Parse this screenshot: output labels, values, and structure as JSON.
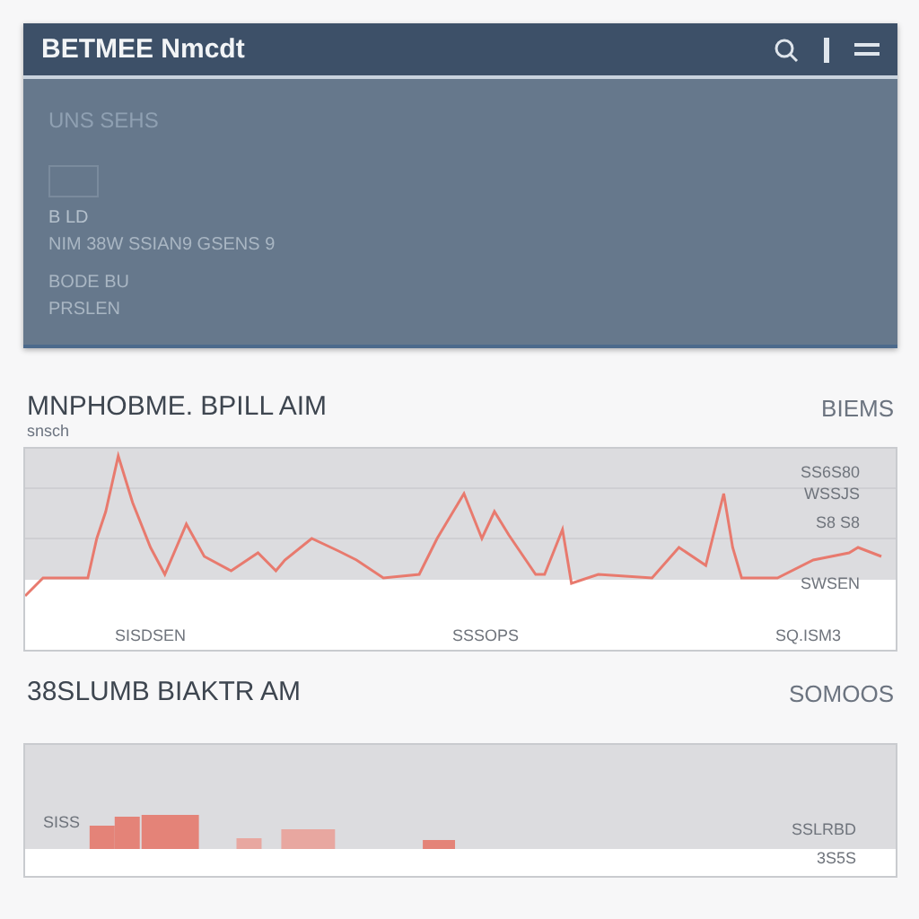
{
  "header": {
    "title": "BETMEE Nmcdt",
    "subtitle": "UNS SEHS",
    "checked": false,
    "lines": [
      "B LD",
      "NIM 38W SSIAN9 GSENS 9",
      "BODE BU",
      "PRSLEN"
    ]
  },
  "trend": {
    "title": "MNPHOBME. BPILL AIM",
    "caption": "snsch",
    "badge": "BIEMS",
    "right_labels": [
      "SS6S80",
      "WSSJS",
      "S8 S8",
      "SWSEN"
    ],
    "x_labels": [
      "SISDSEN",
      "SSSOPS",
      "SQ.ISM3"
    ]
  },
  "volume": {
    "title": "38SLUMB BIAKTR AM",
    "badge": "SOMOOS",
    "left_label": "SISS",
    "right_labels": [
      "SSLRBD",
      "3S5S"
    ]
  }
}
